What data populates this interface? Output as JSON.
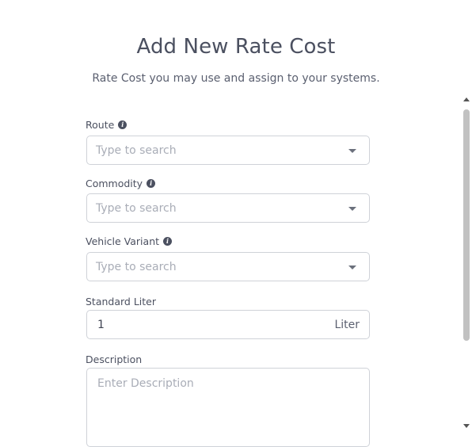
{
  "header": {
    "title": "Add New Rate Cost",
    "subtitle": "Rate Cost you may use and assign to your systems."
  },
  "form": {
    "route": {
      "label": "Route",
      "placeholder": "Type to search"
    },
    "commodity": {
      "label": "Commodity",
      "placeholder": "Type to search"
    },
    "vehicle_variant": {
      "label": "Vehicle Variant",
      "placeholder": "Type to search"
    },
    "standard_liter": {
      "label": "Standard Liter",
      "value": "1",
      "unit": "Liter"
    },
    "description": {
      "label": "Description",
      "placeholder": "Enter Description"
    }
  },
  "icons": {
    "info": "info-icon",
    "dropdown": "chevron-down-icon"
  },
  "colors": {
    "text": "#4b5060",
    "placeholder": "#a9adb7",
    "border": "#cfd2d8",
    "scroll_thumb": "#c1c1c1"
  }
}
